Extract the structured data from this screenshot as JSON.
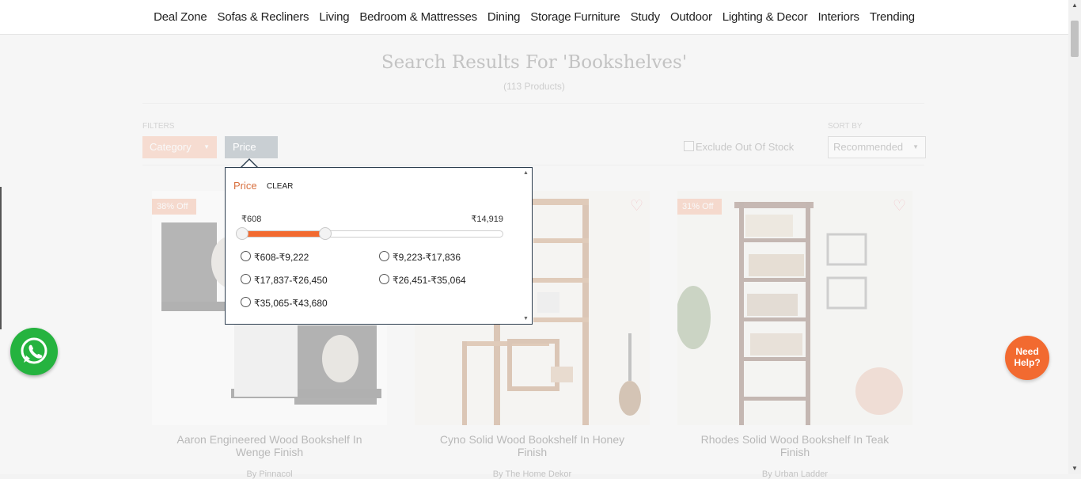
{
  "nav": {
    "items": [
      "Deal Zone",
      "Sofas & Recliners",
      "Living",
      "Bedroom & Mattresses",
      "Dining",
      "Storage Furniture",
      "Study",
      "Outdoor",
      "Lighting & Decor",
      "Interiors",
      "Trending"
    ]
  },
  "search": {
    "title": "Search Results For 'Bookshelves'",
    "count": "(113 Products)"
  },
  "filters": {
    "label": "FILTERS",
    "category_label": "Category",
    "price_label": "Price",
    "exclude_label": "Exclude Out Of Stock",
    "exclude_checked": false
  },
  "sort": {
    "label": "SORT BY",
    "selected": "Recommended"
  },
  "price_dropdown": {
    "title": "Price",
    "clear_label": "CLEAR",
    "min_label": "₹608",
    "max_label": "₹14,919",
    "range_fraction": [
      0.0,
      0.32
    ],
    "accent_color": "#f26a30",
    "options": [
      {
        "label": "₹608-₹9,222",
        "selected": false
      },
      {
        "label": "₹9,223-₹17,836",
        "selected": false
      },
      {
        "label": "₹17,837-₹26,450",
        "selected": false
      },
      {
        "label": "₹26,451-₹35,064",
        "selected": false
      },
      {
        "label": "₹35,065-₹43,680",
        "selected": false
      }
    ]
  },
  "products": [
    {
      "discount": "38% Off",
      "name": "Aaron Engineered Wood Bookshelf In Wenge Finish",
      "brand": "By Pinnacol"
    },
    {
      "discount": "",
      "name": "Cyno Solid Wood Bookshelf In Honey Finish",
      "brand": "By The Home Dekor"
    },
    {
      "discount": "31% Off",
      "name": "Rhodes Solid Wood Bookshelf In Teak Finish",
      "brand": "By Urban Ladder"
    }
  ],
  "help": {
    "line1": "Need",
    "line2": "Help?"
  }
}
